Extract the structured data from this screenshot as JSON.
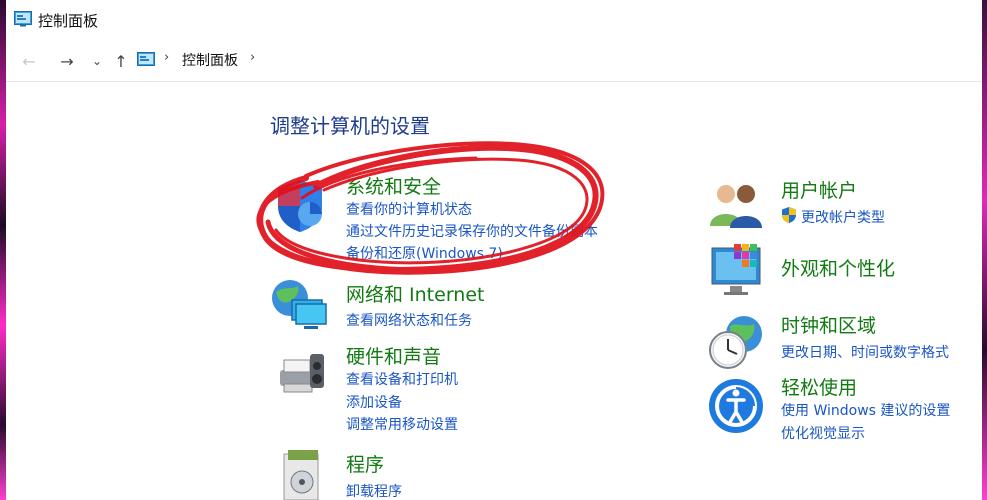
{
  "window": {
    "title": "控制面板"
  },
  "nav": {
    "back": "←",
    "forward": "→",
    "dropdown": "⌄",
    "up": "↑",
    "breadcrumb": [
      "控制面板"
    ],
    "separator": "›"
  },
  "heading": "调整计算机的设置",
  "left_categories": [
    {
      "title": "系统和安全",
      "icon": "system-security-icon",
      "links": [
        "查看你的计算机状态",
        "通过文件历史记录保存你的文件备份副本",
        "备份和还原(Windows 7)"
      ]
    },
    {
      "title": "网络和 Internet",
      "icon": "network-icon",
      "links": [
        "查看网络状态和任务"
      ]
    },
    {
      "title": "硬件和声音",
      "icon": "hardware-sound-icon",
      "links": [
        "查看设备和打印机",
        "添加设备",
        "调整常用移动设置"
      ]
    },
    {
      "title": "程序",
      "icon": "programs-icon",
      "links": [
        "卸载程序"
      ]
    }
  ],
  "right_categories": [
    {
      "title": "用户帐户",
      "icon": "user-accounts-icon",
      "links": [
        "更改帐户类型"
      ]
    },
    {
      "title": "外观和个性化",
      "icon": "appearance-icon",
      "links": []
    },
    {
      "title": "时钟和区域",
      "icon": "clock-region-icon",
      "links": [
        "更改日期、时间或数字格式"
      ]
    },
    {
      "title": "轻松使用",
      "icon": "ease-of-access-icon",
      "links": [
        "使用 Windows 建议的设置",
        "优化视觉显示"
      ]
    }
  ],
  "colors": {
    "title_green": "#127a12",
    "link_blue": "#1a56c4",
    "heading_blue": "#1e3c8c",
    "annotation_red": "#e0101a"
  }
}
